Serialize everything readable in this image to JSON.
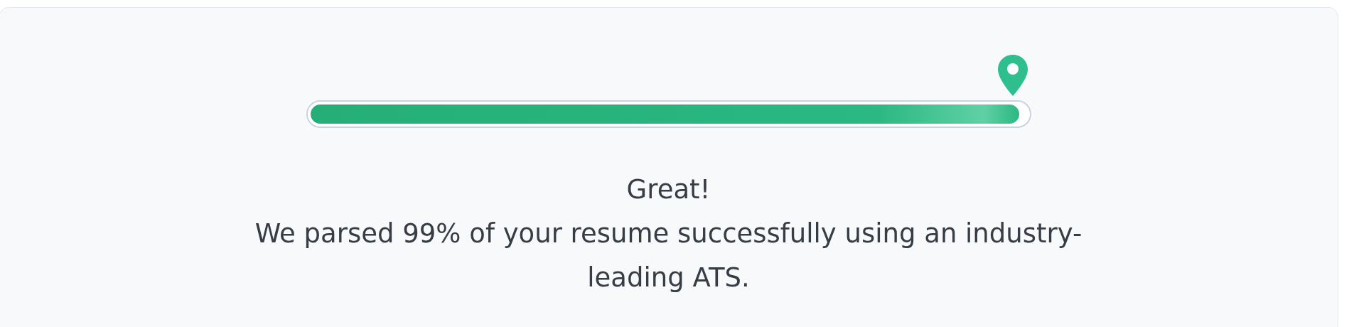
{
  "progress": {
    "level": 0.99
  },
  "message": {
    "title": "Great!",
    "text": "We parsed 99% of your resume successfully using an industry-leading ATS."
  }
}
